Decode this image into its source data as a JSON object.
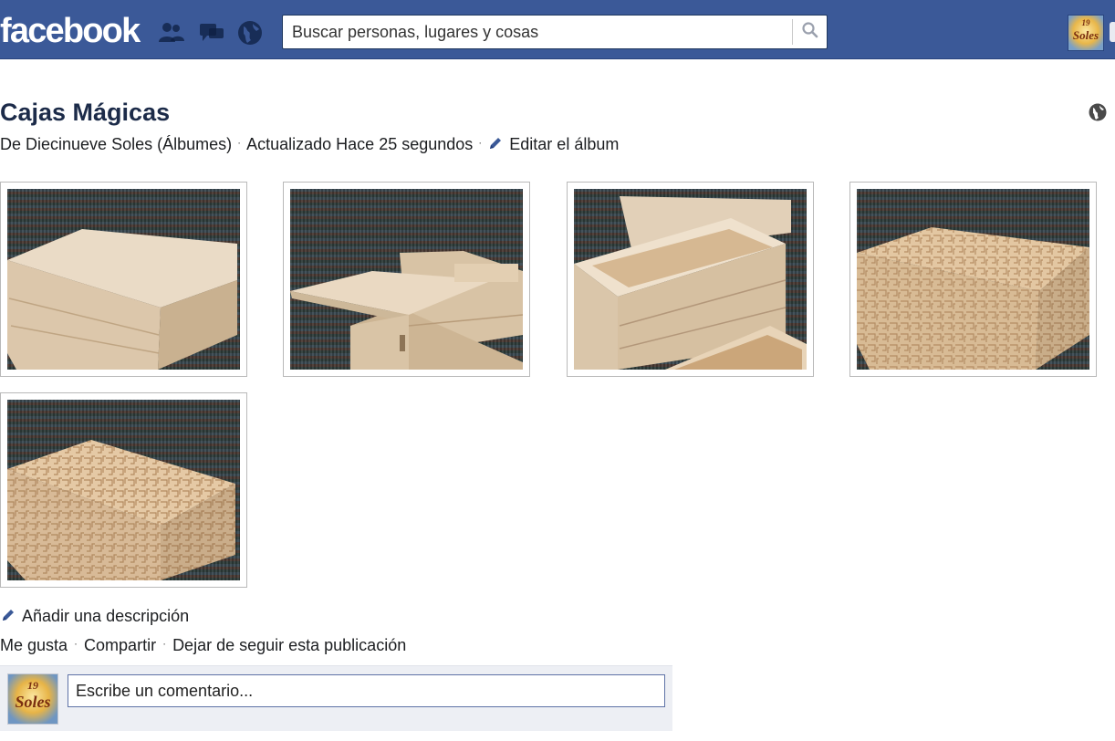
{
  "header": {
    "logo": "facebook",
    "search_placeholder": "Buscar personas, lugares y cosas",
    "avatar_label": "Soles",
    "avatar_number": "19"
  },
  "album": {
    "title": "Cajas Mágicas",
    "author_text": "De Diecinueve Soles (Álbumes)",
    "updated": "Actualizado Hace 25 segundos",
    "edit_label": "Editar el álbum"
  },
  "photos": [
    {
      "alt": "caja cerrada"
    },
    {
      "alt": "caja con tapa deslizante"
    },
    {
      "alt": "caja abierta con bandeja"
    },
    {
      "alt": "caja con laberinto"
    },
    {
      "alt": "caja con laberinto 2"
    }
  ],
  "footer": {
    "add_description": "Añadir una descripción",
    "like": "Me gusta",
    "share": "Compartir",
    "unfollow": "Dejar de seguir esta publicación",
    "comment_placeholder": "Escribe un comentario..."
  },
  "colors": {
    "brand": "#3b5998",
    "comment_bg": "#edeff4"
  },
  "icons": [
    "friend-requests-icon",
    "messages-icon",
    "notifications-globe-icon",
    "search-icon",
    "globe-privacy-icon",
    "pencil-icon"
  ]
}
